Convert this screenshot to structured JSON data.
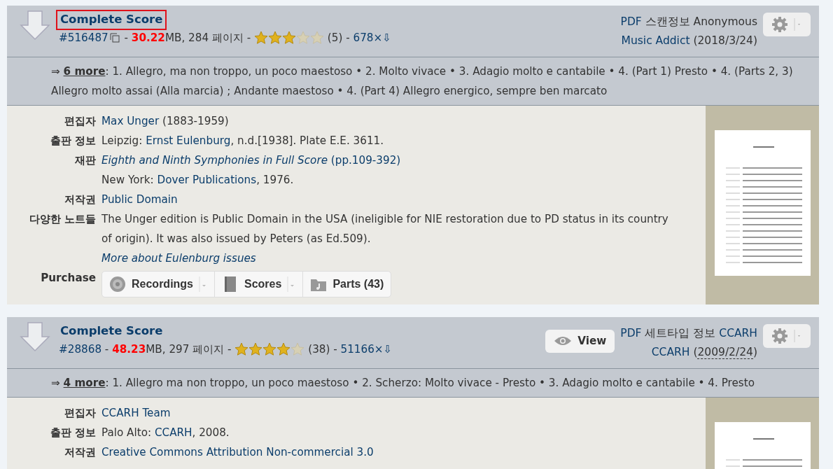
{
  "files": [
    {
      "title": "Complete Score",
      "highlighted": true,
      "meta": [
        {
          "kind": "link",
          "text": "#516487"
        },
        {
          "kind": "copy"
        },
        {
          "kind": "plain",
          "text": " - "
        },
        {
          "kind": "size",
          "text": "30.22"
        },
        {
          "kind": "plain",
          "text": "MB, 284 페이지 - "
        },
        {
          "kind": "stars",
          "stars": 3
        },
        {
          "kind": "plain",
          "text": " (5) - "
        },
        {
          "kind": "link",
          "text": "678×⇩"
        }
      ],
      "uploader": [
        [
          {
            "kind": "link",
            "text": "PDF"
          },
          {
            "kind": "plain",
            "text": " 스캔정보 Anonymous"
          }
        ],
        [
          {
            "kind": "link",
            "text": "Music Addict"
          },
          {
            "kind": "plain",
            "text": " (2018/3/24)"
          }
        ]
      ],
      "movements": [
        {
          "kind": "plain",
          "text": "⇒ "
        },
        {
          "kind": "more",
          "text": "6 more"
        },
        {
          "kind": "plain",
          "text": ": 1. Allegro, ma non troppo, un poco maestoso • 2. Molto vivace • 3. Adagio molto e cantabile • 4. (Part 1) Presto • 4. (Parts 2, 3) Allegro molto assai (Alla marcia) ; Andante maestoso • 4. (Part 4) Allegro energico, sempre ben marcato"
        }
      ],
      "details": [
        {
          "kind": "text",
          "label": "편집자",
          "lines": [
            [
              {
                "kind": "link",
                "text": "Max Unger"
              },
              {
                "kind": "plain",
                "text": " (1883-1959)"
              }
            ]
          ]
        },
        {
          "kind": "text",
          "label": "출판 정보",
          "lines": [
            [
              {
                "kind": "plain",
                "text": "Leipzig: "
              },
              {
                "kind": "link",
                "text": "Ernst Eulenburg"
              },
              {
                "kind": "plain",
                "text": ", n.d.[1938]. Plate E.E. 3611."
              }
            ]
          ]
        },
        {
          "kind": "text",
          "label": "재판",
          "lines": [
            [
              {
                "kind": "italic-link",
                "text": "Eighth and Ninth Symphonies in Full Score"
              },
              {
                "kind": "link",
                "text": " (pp.109-392)"
              }
            ],
            [
              {
                "kind": "plain",
                "text": "New York: "
              },
              {
                "kind": "link",
                "text": "Dover Publications"
              },
              {
                "kind": "plain",
                "text": ", 1976."
              }
            ]
          ]
        },
        {
          "kind": "text",
          "label": "저작권",
          "lines": [
            [
              {
                "kind": "link",
                "text": "Public Domain"
              }
            ]
          ]
        },
        {
          "kind": "text",
          "label": "다양한 노트들",
          "lines": [
            [
              {
                "kind": "plain",
                "text": "The Unger edition is Public Domain in the USA (ineligible for NIE restoration due to PD status in its country of origin). It was also issued by Peters (as Ed.509)."
              }
            ],
            [
              {
                "kind": "italic-link",
                "text": "More about Eulenburg issues"
              }
            ]
          ]
        },
        {
          "kind": "purchase",
          "label": "Purchase",
          "buttons": [
            {
              "label": "Recordings",
              "dropdown": true
            },
            {
              "label": "Scores",
              "dropdown": true
            },
            {
              "label": "Parts (43)",
              "dropdown": false
            }
          ]
        }
      ]
    },
    {
      "title": "Complete Score",
      "highlighted": false,
      "meta": [
        {
          "kind": "link",
          "text": "#28868"
        },
        {
          "kind": "plain",
          "text": " - "
        },
        {
          "kind": "size",
          "text": "48.23"
        },
        {
          "kind": "plain",
          "text": "MB, 297 페이지 - "
        },
        {
          "kind": "stars",
          "stars": 4
        },
        {
          "kind": "plain",
          "text": " (38) - "
        },
        {
          "kind": "link",
          "text": "51166×⇩"
        }
      ],
      "view_button": "View",
      "uploader": [
        [
          {
            "kind": "link",
            "text": "PDF"
          },
          {
            "kind": "plain",
            "text": " 세트타입 정보 "
          },
          {
            "kind": "link",
            "text": "CCARH"
          }
        ],
        [
          {
            "kind": "link",
            "text": "CCARH"
          },
          {
            "kind": "plain",
            "text": " ("
          },
          {
            "kind": "dotted",
            "text": "2009/2/24"
          },
          {
            "kind": "plain",
            "text": ")"
          }
        ]
      ],
      "movements": [
        {
          "kind": "plain",
          "text": "⇒ "
        },
        {
          "kind": "more",
          "text": "4 more"
        },
        {
          "kind": "plain",
          "text": ": 1. Allegro ma non troppo, un poco maestoso • 2. Scherzo: Molto vivace - Presto • 3. Adagio molto e cantabile • 4. Presto"
        }
      ],
      "details": [
        {
          "kind": "text",
          "label": "편집자",
          "lines": [
            [
              {
                "kind": "link",
                "text": "CCARH Team"
              }
            ]
          ]
        },
        {
          "kind": "text",
          "label": "출판 정보",
          "lines": [
            [
              {
                "kind": "plain",
                "text": "Palo Alto: "
              },
              {
                "kind": "link",
                "text": "CCARH"
              },
              {
                "kind": "plain",
                "text": ", 2008."
              }
            ]
          ]
        },
        {
          "kind": "text",
          "label": "저작권",
          "lines": [
            [
              {
                "kind": "link",
                "text": "Creative Commons Attribution Non-commercial 3.0"
              }
            ]
          ]
        }
      ]
    }
  ]
}
